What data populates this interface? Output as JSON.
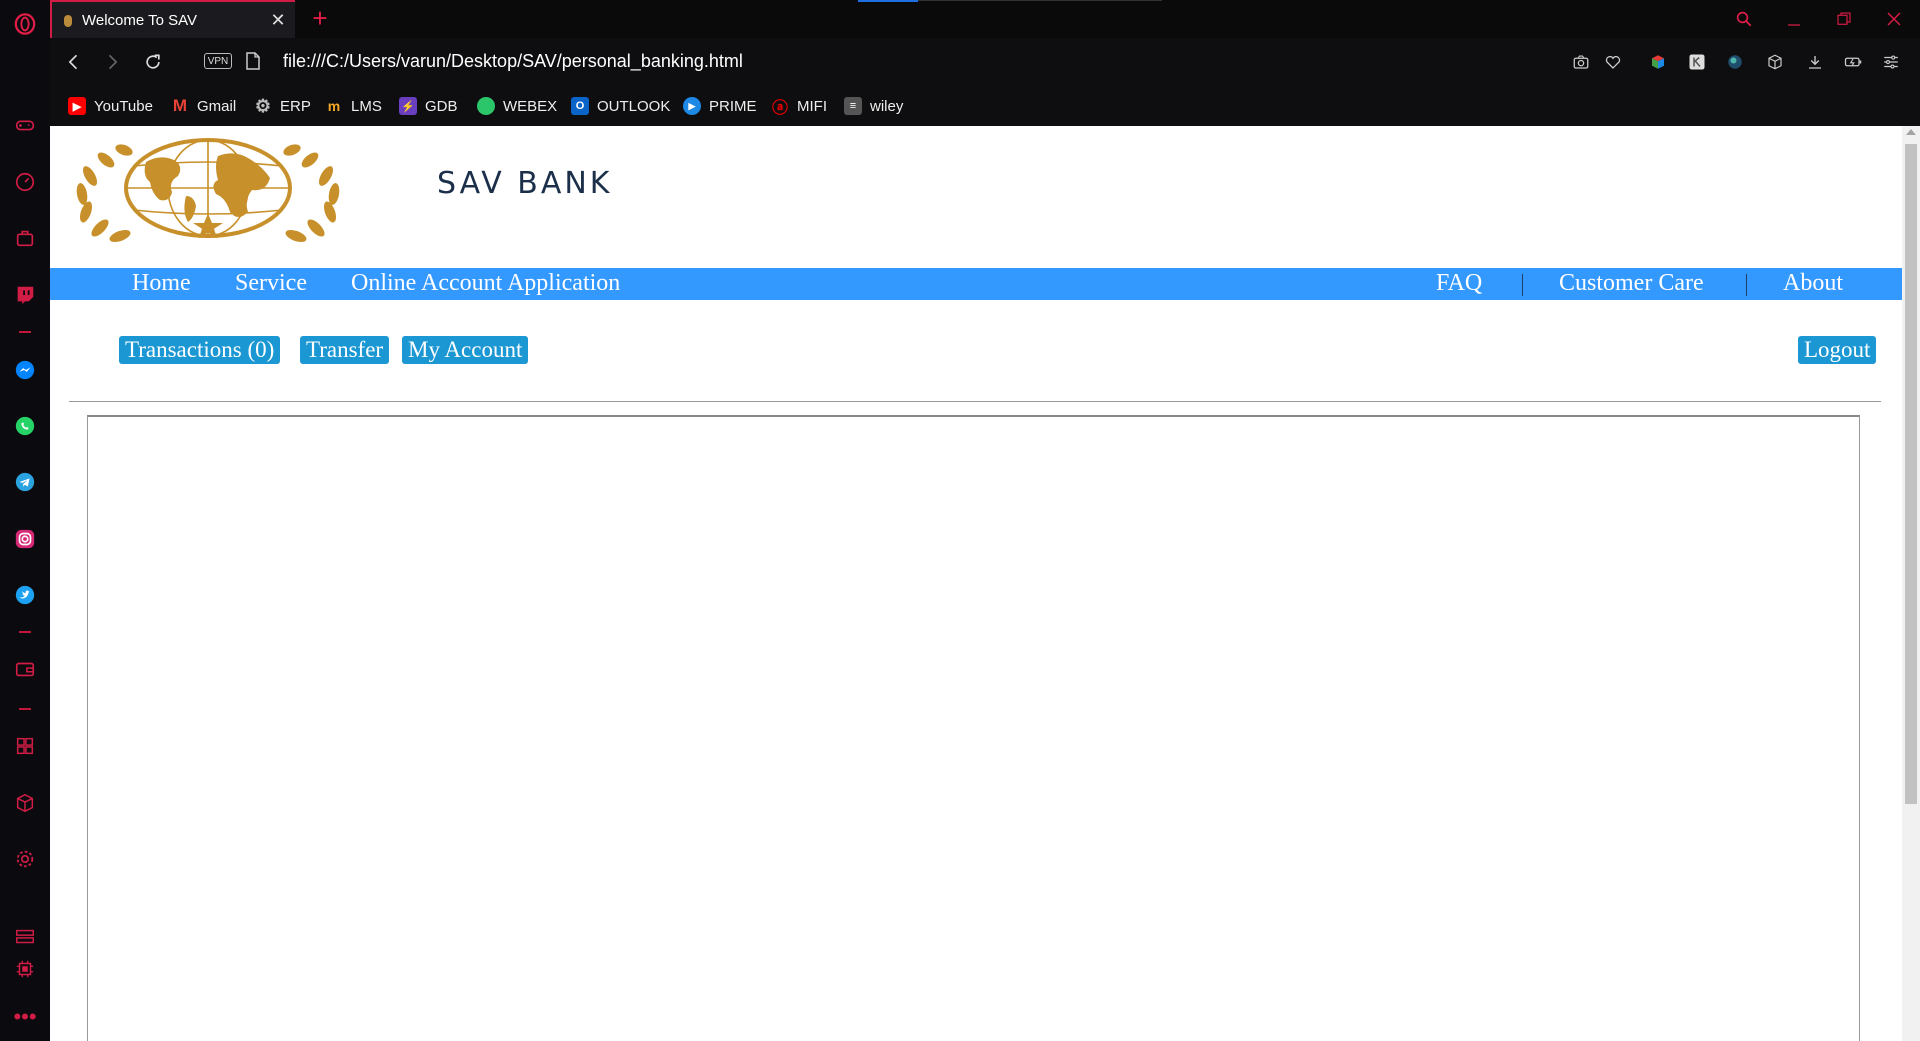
{
  "browser": {
    "tab_title": "Welcome To SAV",
    "url": "file:///C:/Users/varun/Desktop/SAV/personal_banking.html",
    "vpn_label": "VPN",
    "bookmarks": [
      {
        "label": "YouTube",
        "icon": "youtube-icon",
        "color": "#ff0000"
      },
      {
        "label": "Gmail",
        "icon": "gmail-icon",
        "color": "#ea4335"
      },
      {
        "label": "ERP",
        "icon": "gear-icon",
        "color": "#bbbbbb"
      },
      {
        "label": "LMS",
        "icon": "lms-icon",
        "color": "#f5a623"
      },
      {
        "label": "GDB",
        "icon": "gdb-icon",
        "color": "#6a3fbf"
      },
      {
        "label": "WEBEX",
        "icon": "webex-icon",
        "color": "#2cc66a"
      },
      {
        "label": "OUTLOOK",
        "icon": "outlook-icon",
        "color": "#0a64c8"
      },
      {
        "label": "PRIME",
        "icon": "prime-icon",
        "color": "#1e88e5"
      },
      {
        "label": "MIFI",
        "icon": "airtel-icon",
        "color": "#e40000"
      },
      {
        "label": "wiley",
        "icon": "wiley-icon",
        "color": "#555555"
      }
    ]
  },
  "page": {
    "bank_name": "SAV BANK",
    "nav_left": [
      "Home",
      "Service",
      "Online Account Application"
    ],
    "nav_right": [
      "FAQ",
      "Customer Care",
      "About"
    ],
    "actions": {
      "transactions": "Transactions (0)",
      "transfer": "Transfer",
      "my_account": "My Account",
      "logout": "Logout"
    },
    "colors": {
      "nav_bar": "#3399ff",
      "action_button": "#1b97d3",
      "logo_gold": "#c8902a",
      "opera_accent": "#d11c45"
    }
  }
}
